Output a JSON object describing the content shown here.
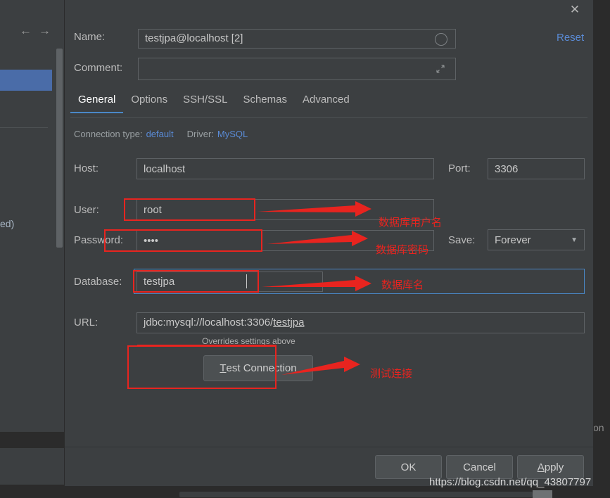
{
  "background": {
    "nav_back_icon": "arrow-left-icon",
    "nav_forward_icon": "arrow-right-icon",
    "partial_text_left": "ed)",
    "partial_text_right": "on"
  },
  "dialog": {
    "close_icon": "close-icon",
    "name": {
      "label": "Name:",
      "value": "testjpa@localhost [2]",
      "placeholder": "",
      "indicator_icon": "circle-icon"
    },
    "reset_label": "Reset",
    "comment": {
      "label": "Comment:",
      "value": "",
      "placeholder": "",
      "expand_icon": "expand-icon"
    },
    "tabs": [
      {
        "label": "General",
        "active": true
      },
      {
        "label": "Options",
        "active": false
      },
      {
        "label": "SSH/SSL",
        "active": false
      },
      {
        "label": "Schemas",
        "active": false
      },
      {
        "label": "Advanced",
        "active": false
      }
    ],
    "meta": {
      "connection_type_label": "Connection type:",
      "connection_type_value": "default",
      "driver_label": "Driver:",
      "driver_value": "MySQL"
    },
    "fields": {
      "host_label": "Host:",
      "host_value": "localhost",
      "port_label": "Port:",
      "port_value": "3306",
      "user_label": "User:",
      "user_value": "root",
      "password_label": "Password:",
      "password_value": "••••",
      "save_label": "Save:",
      "save_value": "Forever",
      "save_caret_icon": "chevron-down-icon",
      "database_label": "Database:",
      "database_value": "testjpa",
      "url_label": "URL:",
      "url_prefix": "jdbc:mysql://localhost:3306/",
      "url_suffix": "testjpa",
      "overrides_note": "Overrides settings above"
    },
    "test_connection": {
      "mnemonic": "T",
      "rest": "est Connection"
    },
    "footer": {
      "ok": "OK",
      "cancel": "Cancel",
      "apply_mnemonic": "A",
      "apply_rest": "pply"
    }
  },
  "annotations": {
    "color": "#e8241f",
    "items": [
      {
        "text": "数据库用户名"
      },
      {
        "text": "数据库密码"
      },
      {
        "text": "数据库名"
      },
      {
        "text": "测试连接"
      }
    ]
  },
  "watermark": "https://blog.csdn.net/qq_43807797",
  "colors": {
    "dialog_bg": "#3c3f41",
    "app_bg": "#2b2b2b",
    "accent_blue": "#4a88c7",
    "link_blue": "#5a8bd6",
    "annotation_red": "#e8241f",
    "selection_blue": "#4a6ca8"
  }
}
